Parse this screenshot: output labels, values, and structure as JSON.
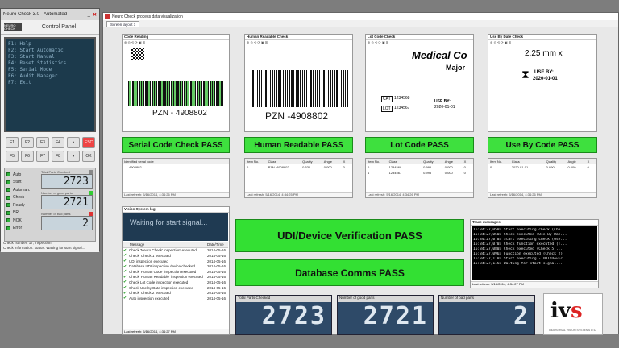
{
  "control_panel": {
    "window_title": "Neuro Check 3.0 - Automated",
    "panel_title": "Control Panel",
    "logo_text": "NEURO CHECK",
    "lcd_lines": [
      "F1: Help",
      "F2: Start Automatic",
      "F3: Start Manual",
      "F4: Reset Statistics",
      "F5: Serial Mode",
      "F6: Audit Manager",
      "F7: Exit"
    ],
    "keys": [
      "F1",
      "F2",
      "F3",
      "F4",
      "▲",
      "ESC",
      "F5",
      "F6",
      "F7",
      "F8",
      "▼",
      "OK"
    ],
    "leds": [
      "Auto",
      "Start",
      "Automan.",
      "Check",
      "Ready",
      "BR",
      "NOK",
      "Error"
    ],
    "counters": [
      {
        "label": "Total Parts Checked",
        "value": "2723"
      },
      {
        "label": "Number of good parts",
        "value": "2721"
      },
      {
        "label": "Number of bad parts",
        "value": "2"
      }
    ],
    "footer": [
      "Check number: 17, inspection",
      "Check information: status: Waiting for start signal..."
    ]
  },
  "main": {
    "window_title": "Neuro Check process data visualization",
    "tab": "Screen layout 1",
    "panels": [
      {
        "title": "Code Reading",
        "pzn": "PZN - 4908802",
        "pass": "Serial Code Check PASS",
        "table": {
          "headers": [
            "Identified serial code"
          ],
          "rows": [
            [
              "4908802"
            ]
          ],
          "foot": "Last refresh: 5/16/2014, 4:34:26 PM"
        }
      },
      {
        "title": "Human Readable Check",
        "pzn": "PZN -4908802",
        "pass": "Human Readable PASS",
        "table": {
          "headers": [
            "Item No.",
            "Class",
            "Quality",
            "Angle",
            "X"
          ],
          "rows": [
            [
              "0",
              "PZN -4908802",
              "0.530",
              "0.000",
              "0"
            ]
          ],
          "foot": "Last refresh: 5/16/2014, 4:34:25 PM"
        }
      },
      {
        "title": "Lot Code Check",
        "big": "Medical Co",
        "sub": "Major",
        "lot_lbl": "LOT",
        "lot": "1234567",
        "cat_lbl": "CAT",
        "cat": "1234568",
        "useby": "USE BY:",
        "date": "2020-01-01",
        "pass": "Lot Code PASS",
        "table": {
          "headers": [
            "Item No.",
            "Class",
            "Quality",
            "Angle",
            "X"
          ],
          "rows": [
            [
              "0",
              "1234568",
              "0.995",
              "0.000",
              "0"
            ],
            [
              "1",
              "1234567",
              "0.995",
              "0.000",
              "0"
            ]
          ],
          "foot": "Last refresh: 5/16/2014, 4:34:26 PM"
        }
      },
      {
        "title": "Use By Date Check",
        "size": "2.25 mm x",
        "useby": "USE BY:",
        "date": "2020-01-01",
        "pass": "Use By Code PASS",
        "table": {
          "headers": [
            "Item No.",
            "Class",
            "Quality",
            "Angle",
            "X"
          ],
          "rows": [
            [
              "0",
              "2020-01-01",
              "0.990",
              "0.000",
              "0"
            ]
          ],
          "foot": "Last refresh: 5/16/2014, 4:34:26 PM"
        }
      }
    ],
    "vision": {
      "title": "Vision System log",
      "waiting": "Waiting for start signal...",
      "headers": [
        "Message",
        "Date/Time"
      ],
      "messages": [
        [
          "Check 'Neuro Check' inspection' executed",
          "2014-05-16"
        ],
        [
          "Check 'Check 1' executed",
          "2014-05-16"
        ],
        [
          "UDI inspection executed",
          "2014-05-16"
        ],
        [
          "Database UDI inspection device checked",
          "2014-05-16"
        ],
        [
          "Check 'Human Code' inspection executed",
          "2014-05-16"
        ],
        [
          "Check 'Human Readable' inspection executed",
          "2014-05-16"
        ],
        [
          "Check Lot Code inspection executed",
          "2014-05-16"
        ],
        [
          "Check Use by Date inspection executed",
          "2014-05-16"
        ],
        [
          "Check 'Check 2' executed",
          "2014-05-16"
        ],
        [
          "Auto inspection executed",
          "2014-05-16"
        ]
      ],
      "foot": "Last refresh: 5/16/2014, 4:34:27 PM"
    },
    "udi_pass": "UDI/Device Verification PASS",
    "db_pass": "Database Comms PASS",
    "trace": {
      "title": "Trace messages",
      "lines": [
        "16:34:27,050> Start executing check (Che...",
        "16:34:27,050> Check executed (Use By Dat...",
        "16:34:27,070> Start executing check (Use...",
        "16:34:27,070> Check function executed (T...",
        "16:34:27,080> Check executed (Check 5)...",
        "16:34:27,096> Function executed (Check 2)",
        "16:34:27,110> Start executing - UDI/Devic...",
        "16:34:27,115> Waiting for start signal..."
      ],
      "foot": "Last refresh: 5/16/2014, 4:34:27 PM"
    },
    "big_counters": [
      {
        "label": "Total Parts Checked",
        "value": "2723"
      },
      {
        "label": "Number of good parts",
        "value": "2721"
      },
      {
        "label": "Number of bad parts",
        "value": "2"
      }
    ],
    "logo": {
      "mark_a": "iv",
      "mark_b": "s",
      "sub": "INDUSTRIAL VISION SYSTEMS LTD"
    }
  }
}
